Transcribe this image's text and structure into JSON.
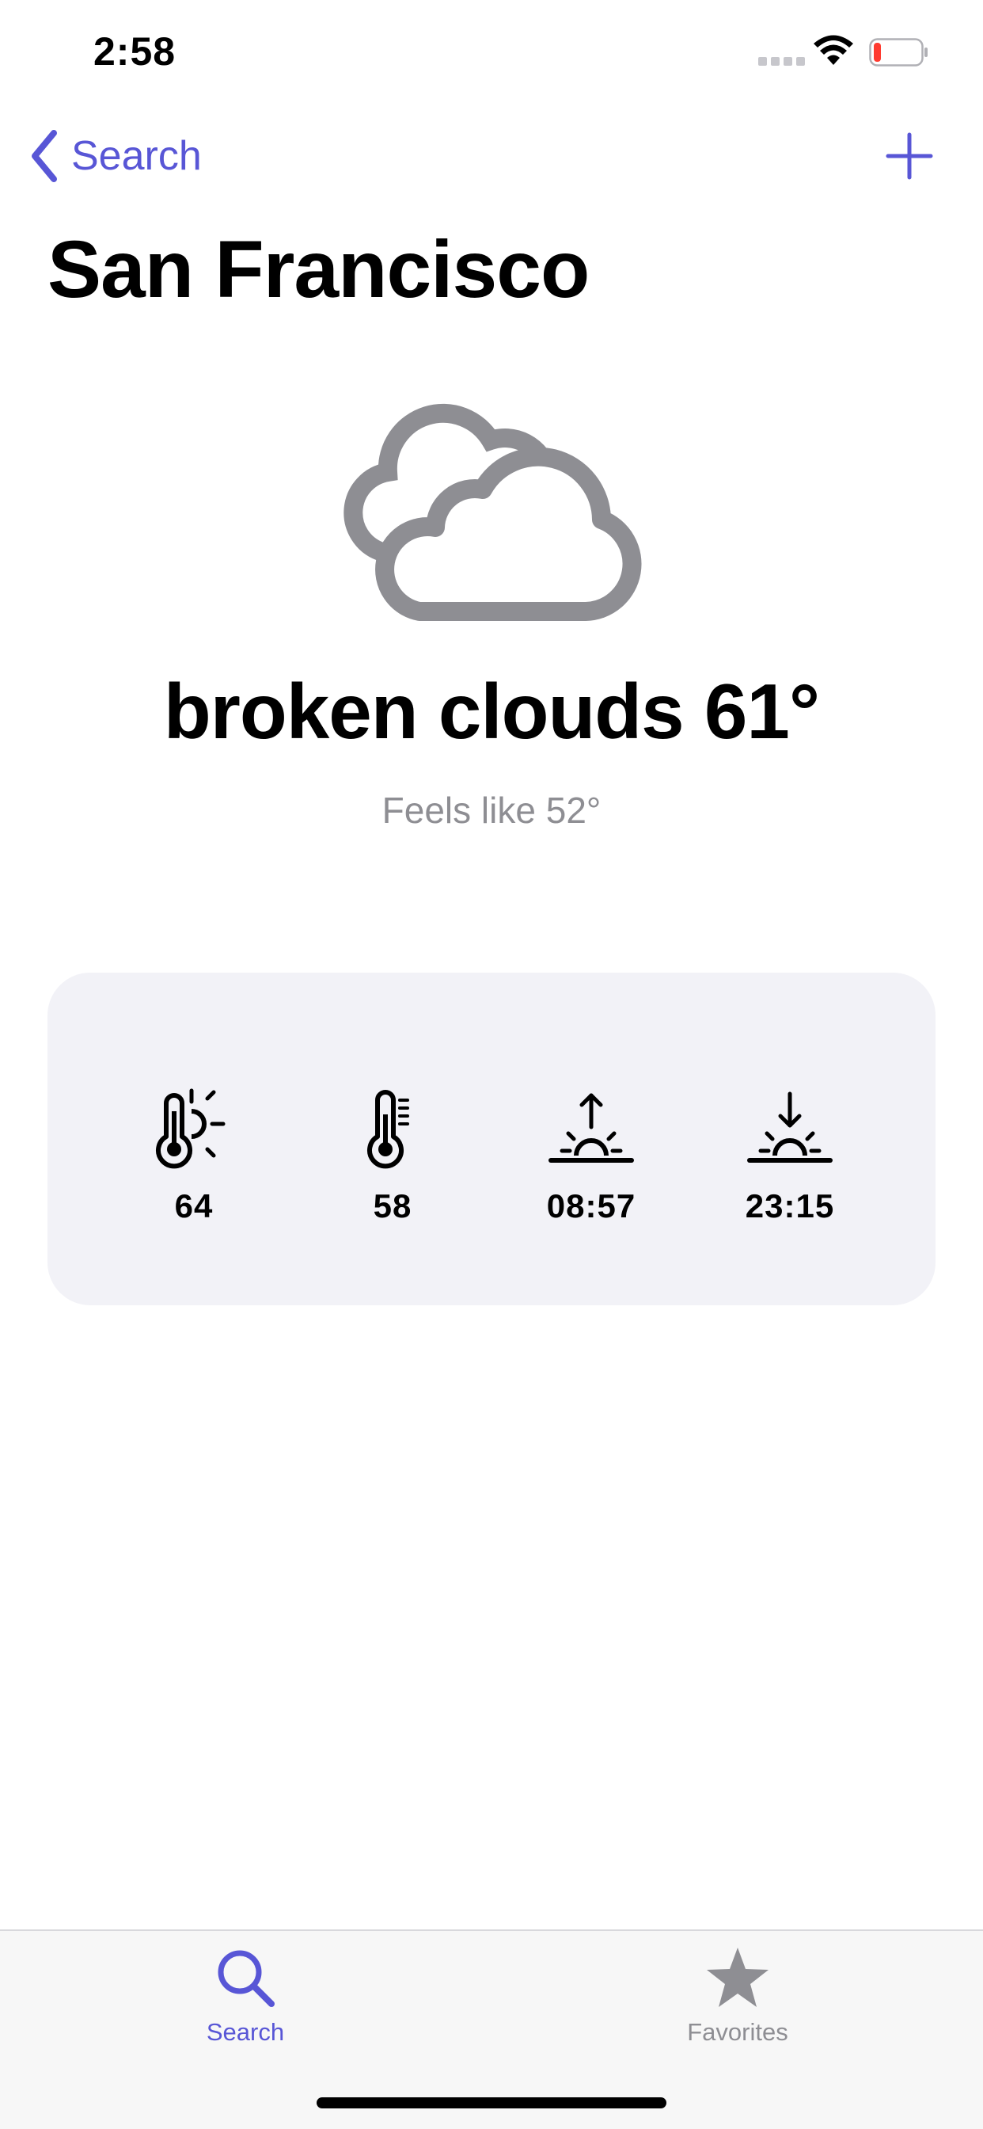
{
  "status_bar": {
    "time": "2:58",
    "battery_color": "#ff3b30"
  },
  "nav": {
    "back_label": "Search",
    "accent_color": "#5856d6"
  },
  "city": "San Francisco",
  "weather": {
    "icon": "cloud-icon",
    "description": "broken clouds",
    "temperature": "61°",
    "feels_like": "Feels like 52°"
  },
  "stats": [
    {
      "icon": "thermometer-sun-icon",
      "value": "64"
    },
    {
      "icon": "thermometer-icon",
      "value": "58"
    },
    {
      "icon": "sunrise-icon",
      "value": "08:57"
    },
    {
      "icon": "sunset-icon",
      "value": "23:15"
    }
  ],
  "tabs": [
    {
      "icon": "search-icon",
      "label": "Search",
      "active": true
    },
    {
      "icon": "star-icon",
      "label": "Favorites",
      "active": false
    }
  ]
}
